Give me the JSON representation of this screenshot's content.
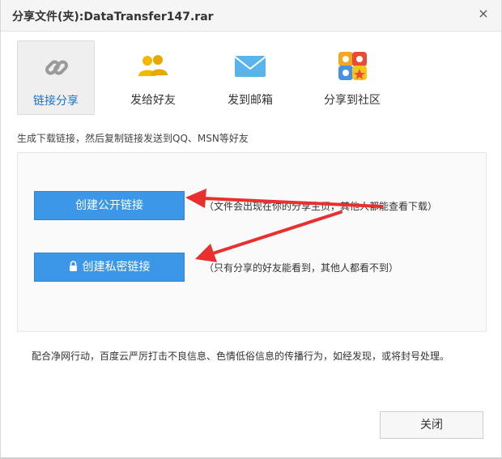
{
  "dialog": {
    "title": "分享文件(夹):DataTransfer147.rar",
    "close_glyph": "×"
  },
  "tabs": [
    {
      "label": "链接分享",
      "icon": "link-icon",
      "active": true
    },
    {
      "label": "发给好友",
      "icon": "friends-icon",
      "active": false
    },
    {
      "label": "发到邮箱",
      "icon": "mail-icon",
      "active": false
    },
    {
      "label": "分享到社区",
      "icon": "community-icon",
      "active": false
    }
  ],
  "description": "生成下载链接，然后复制链接发送到QQ、MSN等好友",
  "public_link": {
    "label": "创建公开链接",
    "note": "（文件会出现在你的分享主页，其他人都能查看下载）"
  },
  "private_link": {
    "label": "创建私密链接",
    "note": "（只有分享的好友能看到，其他人都看不到）"
  },
  "notice": "配合净网行动，百度云严厉打击不良信息、色情低俗信息的传播行为，如经发现，或将封号处理。",
  "footer": {
    "close_label": "关闭"
  },
  "colors": {
    "accent": "#3c97e8",
    "arrow": "#e8312f",
    "tab_active_text": "#1a73c9"
  }
}
